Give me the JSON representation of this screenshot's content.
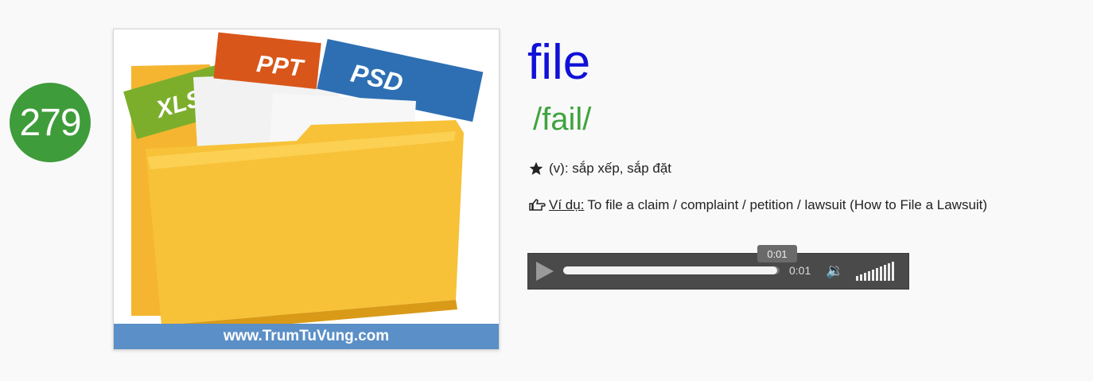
{
  "badge": {
    "number": "279"
  },
  "image": {
    "labels": [
      "XLS",
      "PPT",
      "PSD"
    ],
    "watermark": "www.TrumTuVung.com"
  },
  "entry": {
    "word": "file",
    "ipa": "/fail/",
    "meaning": "(v): sắp xếp, sắp đặt",
    "example_label": "Ví dụ:",
    "example_text": "To file a claim / complaint / petition / lawsuit (How to File a Lawsuit)"
  },
  "player": {
    "current_time": "0:01",
    "tooltip_time": "0:01",
    "progress": 0.99,
    "volume_level": 1.0
  },
  "colors": {
    "badge": "#3e9c3a",
    "word": "#1010d8",
    "ipa": "#3ea33e",
    "watermark_bar": "#5b8fc7"
  }
}
